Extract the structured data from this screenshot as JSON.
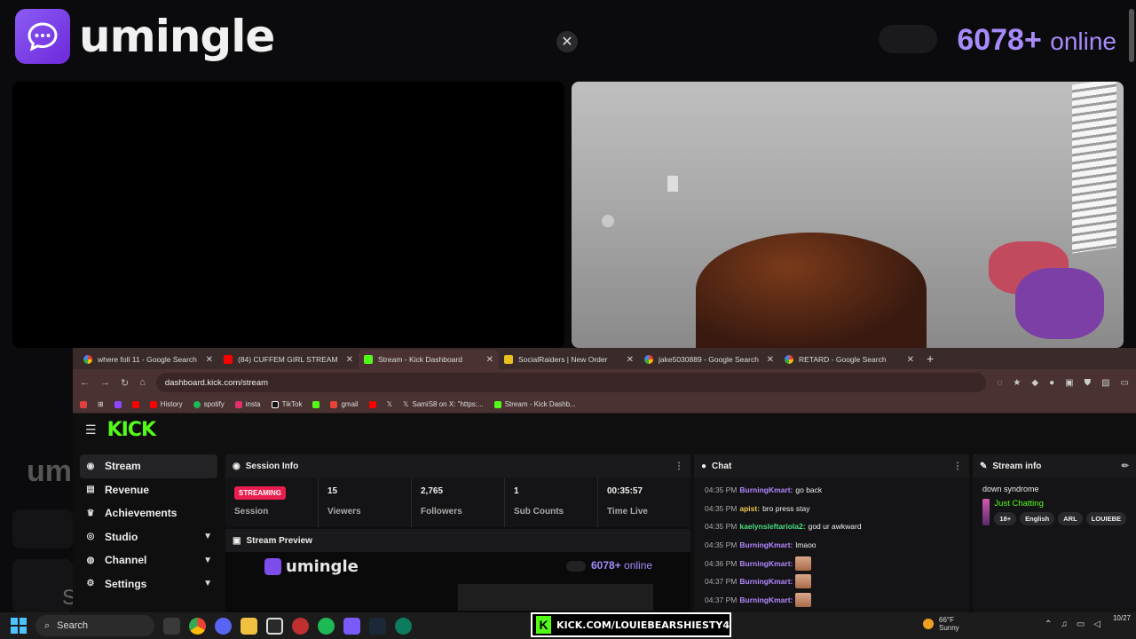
{
  "umingle": {
    "logo_text": "umingle",
    "online_count": "6078+",
    "online_word": "online",
    "close_glyph": "✕",
    "ghost_text": "um",
    "ghost_s": "S"
  },
  "browser": {
    "tabs": [
      {
        "title": "where foll 11 - Google Search",
        "icon": "google-icon"
      },
      {
        "title": "(84) CUFFEM GIRL STREAM",
        "icon": "youtube-icon"
      },
      {
        "title": "Stream - Kick Dashboard",
        "icon": "kick-icon"
      },
      {
        "title": "SocialRaiders | New Order",
        "icon": "socialraiders-icon"
      },
      {
        "title": "jake5030889 - Google Search",
        "icon": "google-icon"
      },
      {
        "title": "RETARD - Google Search",
        "icon": "google-icon"
      }
    ],
    "url": "dashboard.kick.com/stream",
    "bookmarks": [
      "History",
      "spotify",
      "insta",
      "TikTok",
      "gmail",
      "SamiS8 on X: \"https:...",
      "Stream - Kick Dashb..."
    ]
  },
  "kick": {
    "logo": "KICK",
    "sidebar": [
      {
        "label": "Stream",
        "icon": "broadcast-icon",
        "chevron": false
      },
      {
        "label": "Revenue",
        "icon": "revenue-icon",
        "chevron": false
      },
      {
        "label": "Achievements",
        "icon": "trophy-icon",
        "chevron": false
      },
      {
        "label": "Studio",
        "icon": "studio-icon",
        "chevron": true
      },
      {
        "label": "Channel",
        "icon": "channel-icon",
        "chevron": true
      },
      {
        "label": "Settings",
        "icon": "gear-icon",
        "chevron": true
      }
    ],
    "session": {
      "title": "Session Info",
      "status_badge": "STREAMING",
      "stats": [
        {
          "label": "Session",
          "value": ""
        },
        {
          "label": "Viewers",
          "value": "15"
        },
        {
          "label": "Followers",
          "value": "2,765"
        },
        {
          "label": "Sub Counts",
          "value": "1"
        },
        {
          "label": "Time Live",
          "value": "00:35:57"
        }
      ]
    },
    "preview": {
      "title": "Stream Preview",
      "logo_text": "umingle",
      "online_count": "6078+",
      "online_word": "online"
    },
    "chat": {
      "title": "Chat",
      "messages": [
        {
          "time": "04:35 PM",
          "user": "BurningKmart",
          "color": "#b388ff",
          "text": "go back",
          "emote": false
        },
        {
          "time": "04:35 PM",
          "user": "apist",
          "color": "#f2c94c",
          "text": "bro press stay",
          "emote": false
        },
        {
          "time": "04:35 PM",
          "user": "kaelynsleftariola2",
          "color": "#4ade80",
          "text": "god ur awkward",
          "emote": false
        },
        {
          "time": "04:35 PM",
          "user": "BurningKmart",
          "color": "#b388ff",
          "text": "lmaoo",
          "emote": false
        },
        {
          "time": "04:36 PM",
          "user": "BurningKmart",
          "color": "#b388ff",
          "text": "",
          "emote": true
        },
        {
          "time": "04:37 PM",
          "user": "BurningKmart",
          "color": "#b388ff",
          "text": "",
          "emote": true
        },
        {
          "time": "04:37 PM",
          "user": "BurningKmart",
          "color": "#b388ff",
          "text": "",
          "emote": true
        }
      ]
    },
    "stream_info": {
      "title": "Stream info",
      "stream_title": "down syndrome",
      "category": "Just Chatting",
      "tags": [
        "18+",
        "English",
        "ARL",
        "LOUIEBE"
      ]
    }
  },
  "taskbar": {
    "search_label": "Search",
    "kick_banner": "KICK.COM/LOUIEBEARSHIESTY4",
    "weather_temp": "66°F",
    "weather_desc": "Sunny",
    "clock_date": "10/27"
  },
  "colors": {
    "kick_green": "#53fc18",
    "umingle_purple": "#a78bfa",
    "streaming_red": "#e91e4f"
  }
}
